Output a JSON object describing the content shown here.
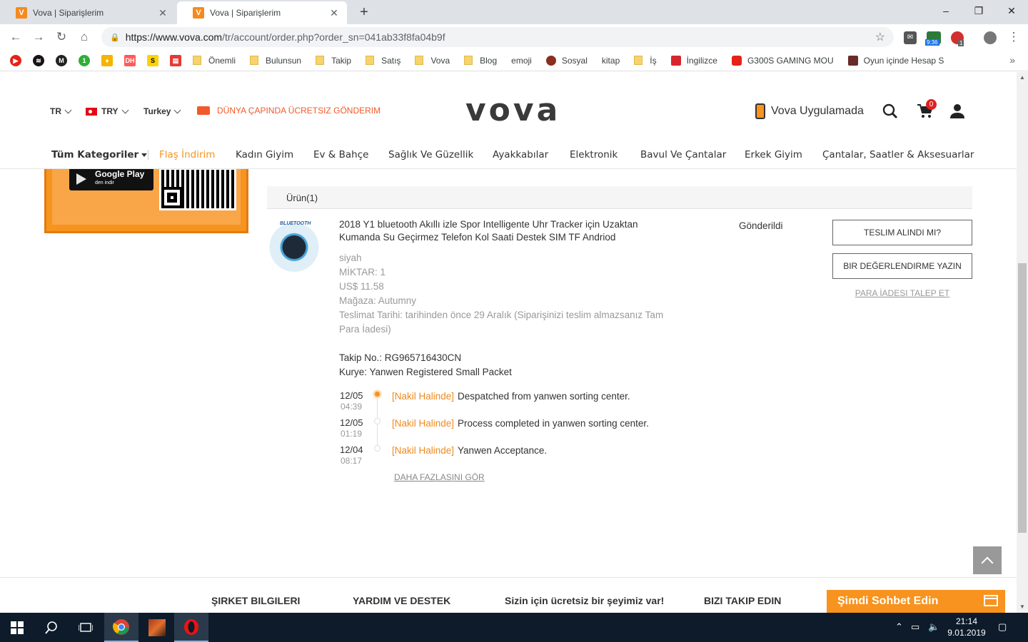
{
  "browser": {
    "tabs": [
      {
        "title": "Vova | Siparişlerim",
        "favicon": "V"
      },
      {
        "title": "Vova | Siparişlerim",
        "favicon": "V"
      }
    ],
    "new_tab": "+",
    "url_host": "https://www.vova.com",
    "url_rest": "/tr/account/order.php?order_sn=041ab33f8fa04b9f",
    "window_controls": {
      "minimize": "–",
      "maximize": "❐",
      "close": "✕"
    },
    "ext_badge_time": "9:36",
    "ext_badge_count": "1",
    "bookmarks": [
      {
        "label": "Önemli",
        "kind": "folder"
      },
      {
        "label": "Bulunsun",
        "kind": "folder"
      },
      {
        "label": "Takip",
        "kind": "folder"
      },
      {
        "label": "Satış",
        "kind": "folder"
      },
      {
        "label": "Vova",
        "kind": "folder"
      },
      {
        "label": "Blog",
        "kind": "folder"
      },
      {
        "label": "emoji",
        "kind": "page"
      },
      {
        "label": "Sosyal",
        "kind": "dot"
      },
      {
        "label": "kitap",
        "kind": "page"
      },
      {
        "label": "İş",
        "kind": "folder"
      },
      {
        "label": "İngilizce",
        "kind": "dot"
      },
      {
        "label": "G300S GAMING MOU",
        "kind": "dot"
      },
      {
        "label": "Oyun içinde Hesap S",
        "kind": "dot"
      }
    ],
    "bookmarks_more": "»"
  },
  "header": {
    "lang": "TR",
    "currency": "TRY",
    "country": "Turkey",
    "shipping_notice": "DÜNYA ÇAPINDA ÜCRETSIZ GÖNDERIM",
    "logo": "vova",
    "app_link": "Vova Uygulamada",
    "cart_count": "0"
  },
  "categories": {
    "all": "Tüm Kategoriler",
    "items": [
      "Flaş İndirim",
      "Kadın Giyim",
      "Ev & Bahçe",
      "Sağlık Ve Güzellik",
      "Ayakkabılar",
      "Elektronik",
      "Bavul Ve Çantalar",
      "Erkek Giyim",
      "Çantalar, Saatler & Aksesuarlar"
    ]
  },
  "banner": {
    "store_name": "Google Play",
    "store_sub": "den indir"
  },
  "order": {
    "section_header": "Ürün(1)",
    "thumb_label": "BLUETOOTH",
    "product_title": "2018 Y1 bluetooth Akıllı izle Spor Intelligente Uhr Tracker için Uzaktan Kumanda Su Geçirmez Telefon Kol Saati Destek SIM TF Andriod",
    "color": "siyah",
    "quantity": "MİKTAR: 1",
    "price": "US$ 11.58",
    "store": "Mağaza: Autumny",
    "delivery_line1": "Teslimat Tarihi: tarihinden önce 29 Aralık (Siparişinizi teslim almazsanız Tam",
    "delivery_line2": "Para İadesi)",
    "tracking": "Takip No.: RG965716430CN",
    "courier": "Kurye: Yanwen Registered Small Packet",
    "status": "Gönderildi",
    "btn_received": "TESLIM ALINDI MI?",
    "btn_review": "BIR DEĞERLENDIRME YAZIN",
    "refund_link": "PARA İADESI TALEP ET",
    "timeline": [
      {
        "date": "12/05",
        "time": "04:39",
        "status": "[Nakil Halinde]",
        "text": "Despatched from yanwen sorting center."
      },
      {
        "date": "12/05",
        "time": "01:19",
        "status": "[Nakil Halinde]",
        "text": "Process completed in yanwen sorting center."
      },
      {
        "date": "12/04",
        "time": "08:17",
        "status": "[Nakil Halinde]",
        "text": "Yanwen Acceptance."
      }
    ],
    "more_link": "DAHA FAZLASINI GÖR"
  },
  "footer": {
    "company": "ŞIRKET BILGILERI",
    "help": "YARDIM VE DESTEK",
    "gift": "Sizin için ücretsiz bir şeyimiz var!",
    "follow": "BIZI TAKIP EDIN",
    "chat": "Şimdi Sohbet Edin"
  },
  "taskbar": {
    "time": "21:14",
    "date": "9.01.2019"
  },
  "colors": {
    "accent": "#f7931e",
    "ship_red": "#f25a29",
    "taskbar": "#0d1b2a"
  }
}
